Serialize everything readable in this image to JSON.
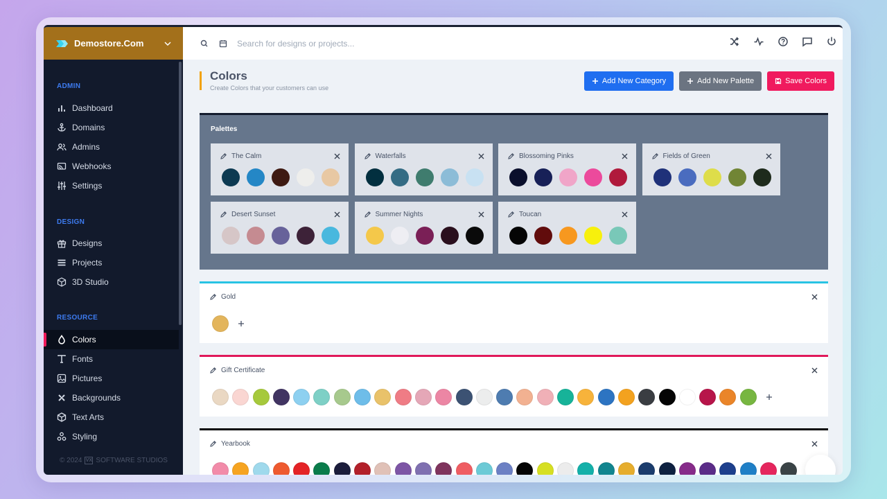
{
  "brand": {
    "name": "Demostore.Com"
  },
  "sidebar": {
    "sections": [
      {
        "title": "ADMIN",
        "items": [
          {
            "label": "Dashboard",
            "icon": "bar-chart-icon"
          },
          {
            "label": "Domains",
            "icon": "anchor-icon"
          },
          {
            "label": "Admins",
            "icon": "users-icon"
          },
          {
            "label": "Webhooks",
            "icon": "cast-icon"
          },
          {
            "label": "Settings",
            "icon": "sliders-icon"
          }
        ]
      },
      {
        "title": "DESIGN",
        "items": [
          {
            "label": "Designs",
            "icon": "gift-icon"
          },
          {
            "label": "Projects",
            "icon": "list-icon"
          },
          {
            "label": "3D Studio",
            "icon": "cube-icon"
          }
        ]
      },
      {
        "title": "RESOURCE",
        "items": [
          {
            "label": "Colors",
            "icon": "droplet-icon",
            "active": true
          },
          {
            "label": "Fonts",
            "icon": "type-icon"
          },
          {
            "label": "Pictures",
            "icon": "image-icon"
          },
          {
            "label": "Backgrounds",
            "icon": "pattern-icon"
          },
          {
            "label": "Text Arts",
            "icon": "box-icon"
          },
          {
            "label": "Styling",
            "icon": "circles-icon"
          }
        ]
      }
    ],
    "footer": {
      "year": "© 2024",
      "badge": "VX",
      "company": "SOFTWARE STUDIOS"
    }
  },
  "topbar": {
    "search_placeholder": "Search for designs or projects..."
  },
  "page": {
    "title": "Colors",
    "subtitle": "Create Colors that your customers can use",
    "buttons": {
      "add_category": "Add New Category",
      "add_palette": "Add New Palette",
      "save": "Save Colors"
    }
  },
  "palettes": {
    "title": "Palettes",
    "items": [
      {
        "name": "The Calm",
        "colors": [
          "#0d3a52",
          "#2487c6",
          "#3e1a12",
          "#eeeeec",
          "#e8c8a3"
        ]
      },
      {
        "name": "Waterfalls",
        "colors": [
          "#022f3f",
          "#346c84",
          "#3f7c6e",
          "#8cbcd7",
          "#c8e1f2"
        ]
      },
      {
        "name": "Blossoming Pinks",
        "colors": [
          "#0b0f2c",
          "#172057",
          "#f0a5c8",
          "#ec4a9c",
          "#b01a3c"
        ]
      },
      {
        "name": "Fields of Green",
        "colors": [
          "#1f3179",
          "#4a6cbf",
          "#dedd4a",
          "#718535",
          "#1e2b1c"
        ]
      },
      {
        "name": "Desert Sunset",
        "colors": [
          "#d6c6c7",
          "#c58b91",
          "#67629a",
          "#3d2238",
          "#49b8de"
        ]
      },
      {
        "name": "Summer Nights",
        "colors": [
          "#f4c84a",
          "#eeeef3",
          "#7a1f56",
          "#2a0f1d",
          "#0a0a0a"
        ]
      },
      {
        "name": "Toucan",
        "colors": [
          "#050505",
          "#610c0c",
          "#f7981f",
          "#f7f00c",
          "#79c8b8"
        ]
      }
    ]
  },
  "categories": [
    {
      "name": "Gold",
      "accent": "#28c3e3",
      "colors": [
        "#e3b55c"
      ]
    },
    {
      "name": "Gift Certificate",
      "accent": "#e0185a",
      "colors": [
        "#ead8c3",
        "#fad6d2",
        "#a6c93c",
        "#413462",
        "#8dd0f0",
        "#7ed0c6",
        "#a7c98d",
        "#6ebde9",
        "#e9c26a",
        "#ef7c85",
        "#e5a7b7",
        "#ec86a4",
        "#3c5273",
        "#eceded",
        "#4e7cb0",
        "#f2b191",
        "#f0b0b7",
        "#17b399",
        "#f7b33b",
        "#2d74c2",
        "#f3a21f",
        "#3a3d42",
        "#050505",
        "#ffffff",
        "#b7154a",
        "#ea8529",
        "#77b641"
      ]
    },
    {
      "name": "Yearbook",
      "accent": "#050505",
      "colors": [
        "#f28ba9",
        "#f6a421",
        "#9fd9ec",
        "#ee5a2f",
        "#e42326",
        "#0a7c4b",
        "#1b1d3b",
        "#b2202a",
        "#e0c1b7",
        "#7d55a5",
        "#7f70b0",
        "#7f345d",
        "#ef5d62",
        "#6ccad6",
        "#6c80c4",
        "#050505",
        "#d6df23",
        "#ececec",
        "#14b0a9",
        "#11858f",
        "#e6ad2d",
        "#1b3c6c",
        "#0e2140",
        "#862b89",
        "#5b2c88",
        "#1d3f8c",
        "#1f7fc6",
        "#e5265d",
        "#3a4346"
      ]
    }
  ]
}
